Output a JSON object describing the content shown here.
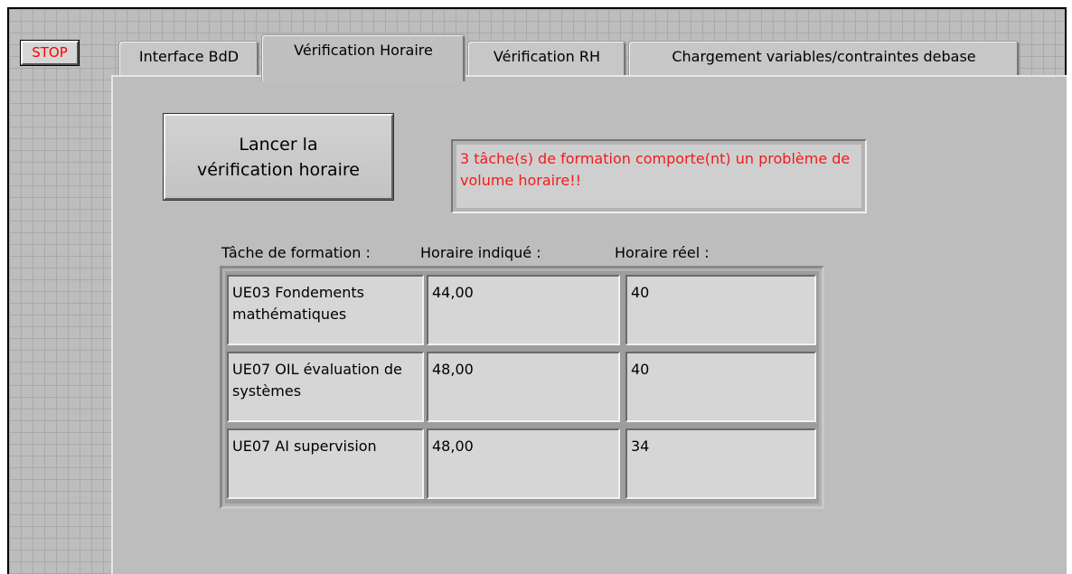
{
  "stop_button": {
    "label": "STOP",
    "color": "#ff0000"
  },
  "tabs": [
    {
      "label": "Interface BdD"
    },
    {
      "label": "Vérification Horaire",
      "active": true
    },
    {
      "label": "Vérification RH"
    },
    {
      "label": "Chargement variables/contraintes debase"
    }
  ],
  "run_button": {
    "line1": "Lancer la",
    "line2": "vérification horaire"
  },
  "message": {
    "text": "3 tâche(s) de formation comporte(nt) un problème de volume horaire!!",
    "color": "#f21b1b"
  },
  "table": {
    "headers": [
      "Tâche de formation :",
      "Horaire indiqué :",
      "Horaire réel :"
    ],
    "rows": [
      {
        "task": "UE03 Fondements mathématiques",
        "indicated": "44,00",
        "real": "40"
      },
      {
        "task": "UE07 OIL évaluation de systèmes",
        "indicated": "48,00",
        "real": "40"
      },
      {
        "task": "UE07 AI supervision",
        "indicated": "48,00",
        "real": "34"
      }
    ]
  }
}
